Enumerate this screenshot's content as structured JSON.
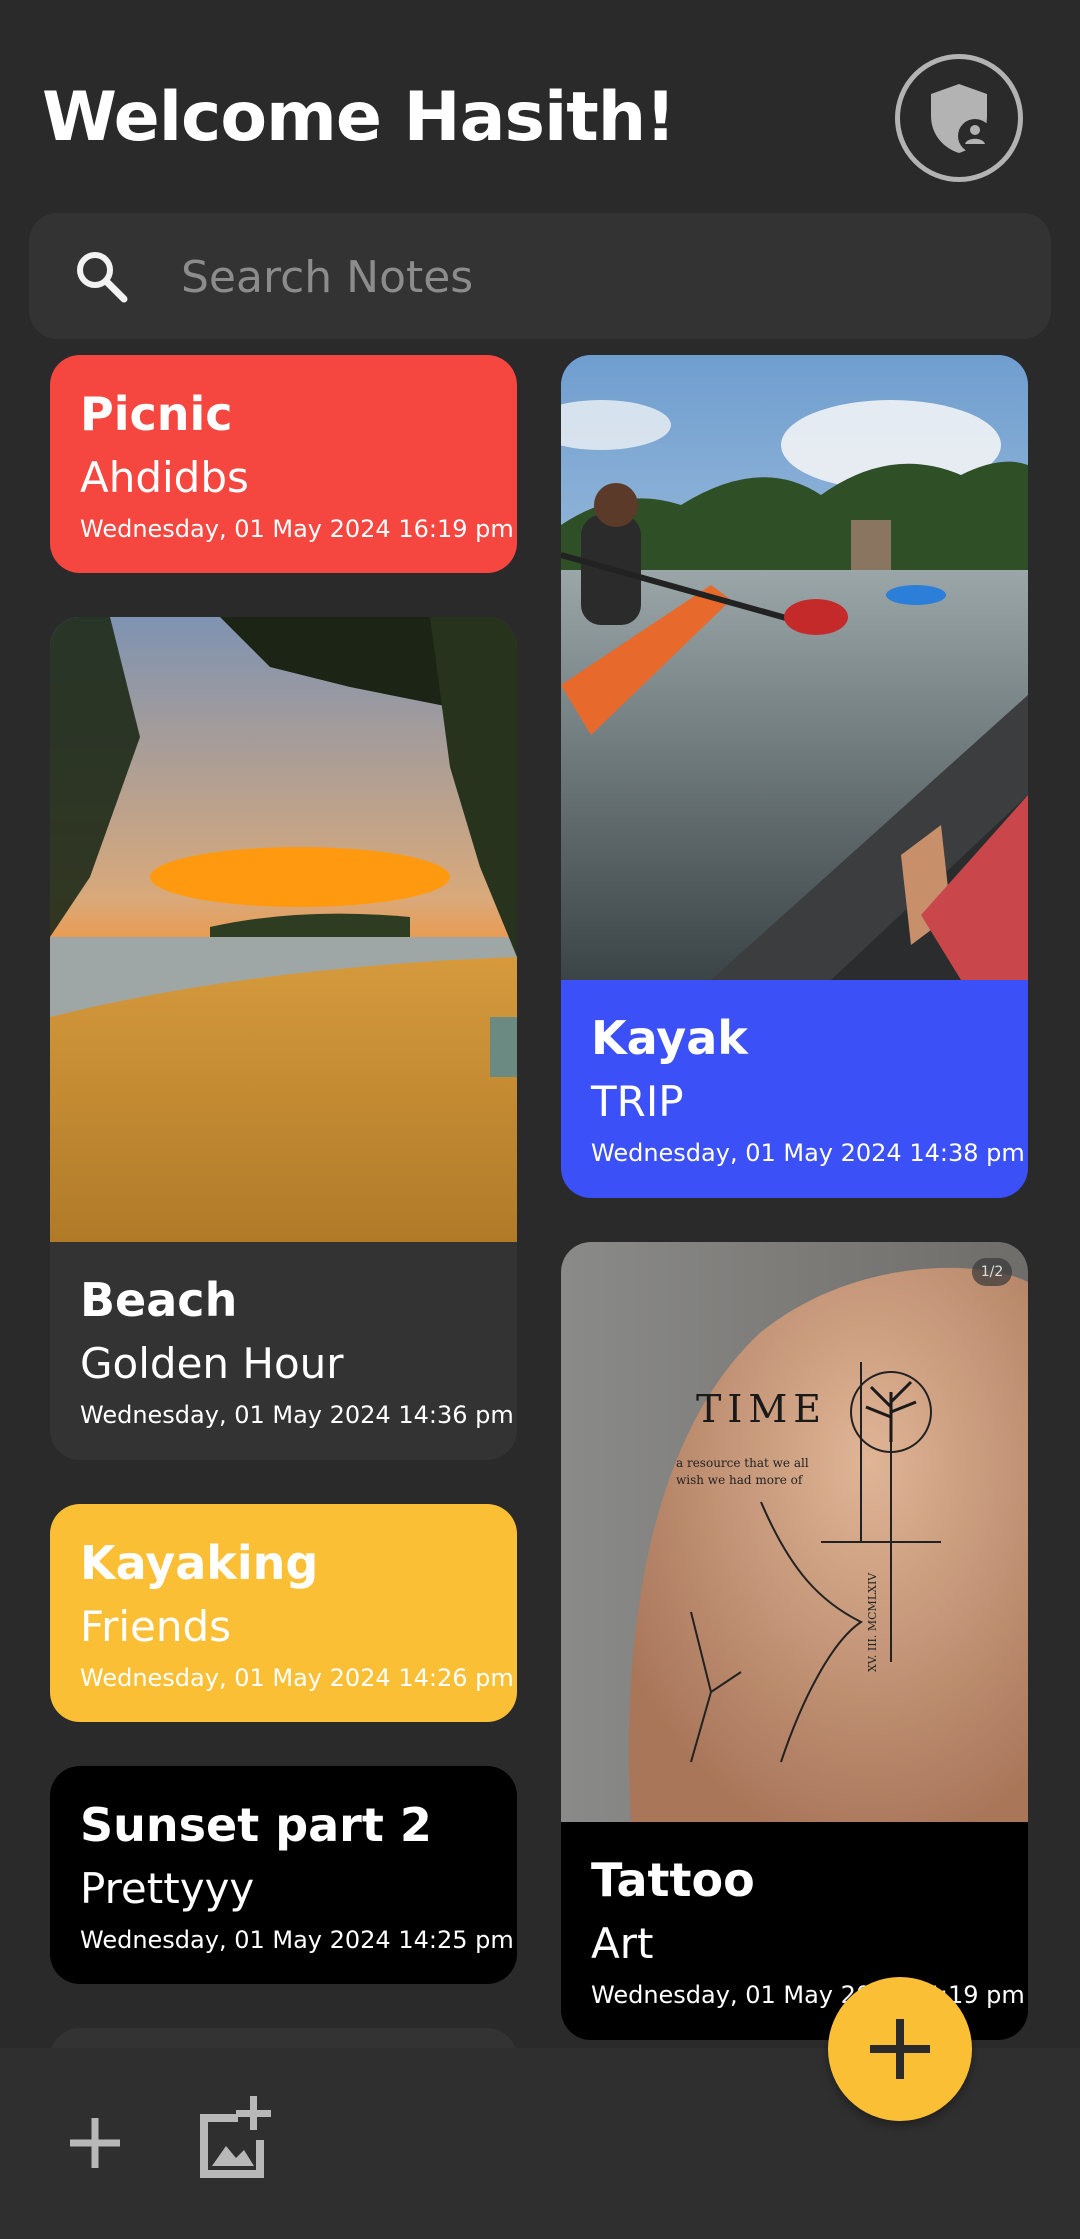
{
  "header": {
    "title": "Welcome Hasith!"
  },
  "search": {
    "placeholder": "Search Notes"
  },
  "notes": [
    {
      "title": "Picnic",
      "subtitle": "Ahdidbs",
      "date": "Wednesday, 01 May 2024 16:19 pm",
      "color": "#f64640"
    },
    {
      "title": "Kayak",
      "subtitle": "TRIP",
      "date": "Wednesday, 01 May 2024 14:38 pm",
      "color": "#3b50f7"
    },
    {
      "title": "Beach",
      "subtitle": "Golden Hour",
      "date": "Wednesday, 01 May 2024 14:36 pm",
      "color": "#333333"
    },
    {
      "title": "Kayaking",
      "subtitle": "Friends",
      "date": "Wednesday, 01 May 2024 14:26 pm",
      "color": "#fbbf36"
    },
    {
      "title": "Sunset part 2",
      "subtitle": "Prettyyy",
      "date": "Wednesday, 01 May 2024 14:25 pm",
      "color": "#000000"
    },
    {
      "title": "Tattoo",
      "subtitle": "Art",
      "date": "Wednesday, 01 May 2024 14:19 pm",
      "color": "#000000",
      "image_badge": "1/2"
    }
  ],
  "tattoo_image_text": {
    "word": "TIME",
    "line1": "a resource that we all",
    "line2": "wish we had more of",
    "numerals": "XV. III. MCMLXIV"
  },
  "icons": {
    "avatar": "shield-person-icon",
    "search": "search-icon",
    "add_note": "plus-icon",
    "add_image": "add-photo-icon",
    "fab": "plus-icon"
  },
  "colors": {
    "background": "#2a2a2a",
    "accent": "#fbbf36"
  }
}
